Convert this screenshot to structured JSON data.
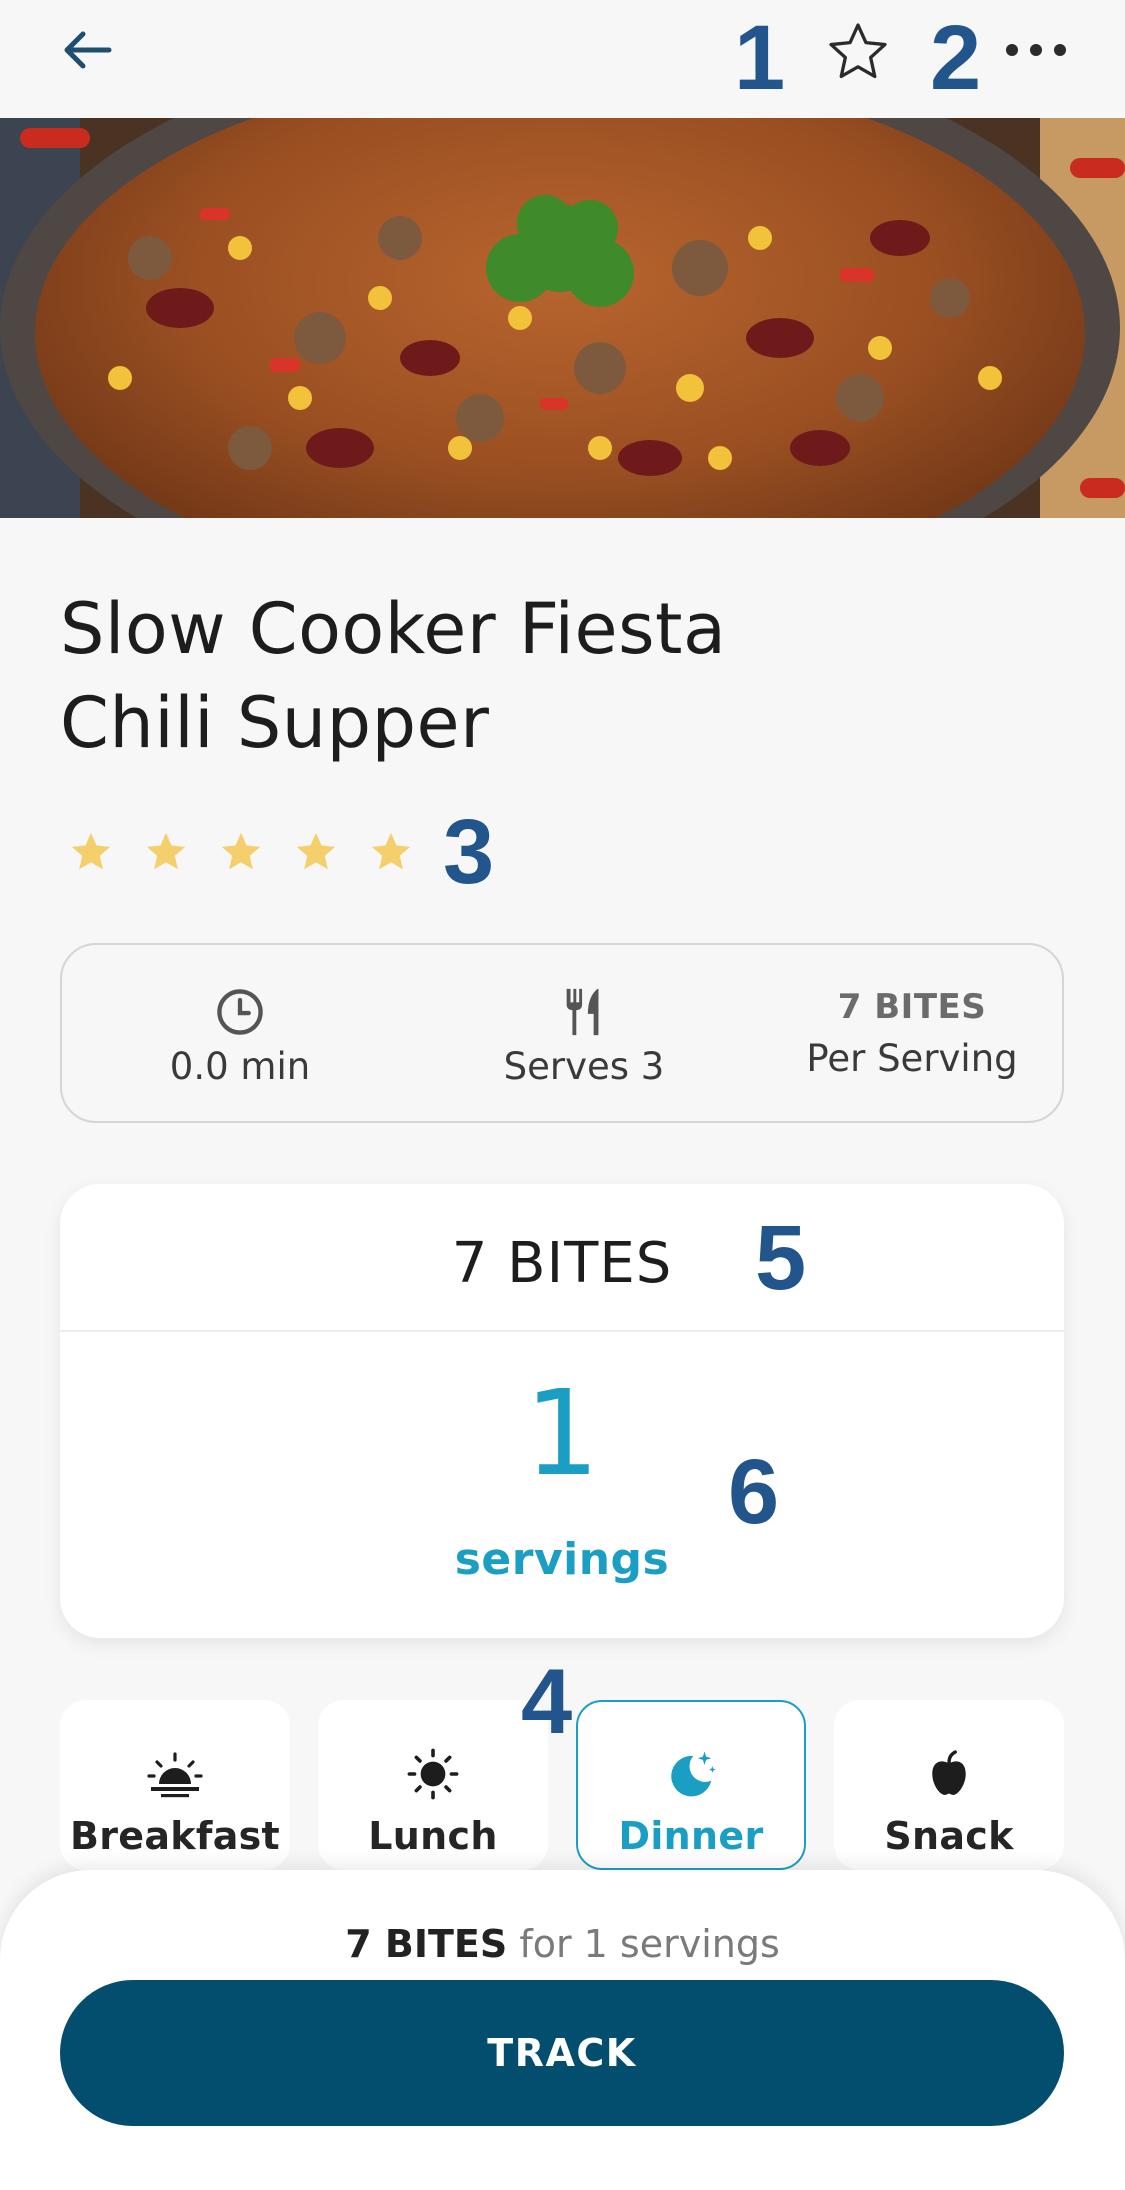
{
  "header": {
    "back_icon": "arrow-left-icon",
    "favorite_icon": "star-outline-icon",
    "more_icon": "more-horizontal-icon"
  },
  "annotations": {
    "a1": "1",
    "a2": "2",
    "a3": "3",
    "a4": "4",
    "a5": "5",
    "a6": "6"
  },
  "recipe": {
    "title_line1": "Slow Cooker Fiesta",
    "title_line2": "Chili Supper",
    "rating_stars": 5,
    "rating_color": "#f5cf6b"
  },
  "info": {
    "time": "0.0 min",
    "serves": "Serves 3",
    "bites": "7 BITES",
    "per_serving": "Per Serving"
  },
  "servings_card": {
    "bites_total": "7 BITES",
    "count": "1",
    "unit": "servings"
  },
  "meals": [
    {
      "label": "Breakfast",
      "icon": "sunrise-icon",
      "selected": false
    },
    {
      "label": "Lunch",
      "icon": "sun-icon",
      "selected": false
    },
    {
      "label": "Dinner",
      "icon": "moon-stars-icon",
      "selected": true
    },
    {
      "label": "Snack",
      "icon": "apple-icon",
      "selected": false
    }
  ],
  "footer": {
    "summary_bites": "7 BITES",
    "summary_rest": "for 1 servings",
    "track_label": "TRACK"
  },
  "colors": {
    "accent": "#1a9ec4",
    "primary_button": "#034d6e",
    "annotation": "#22558c"
  }
}
